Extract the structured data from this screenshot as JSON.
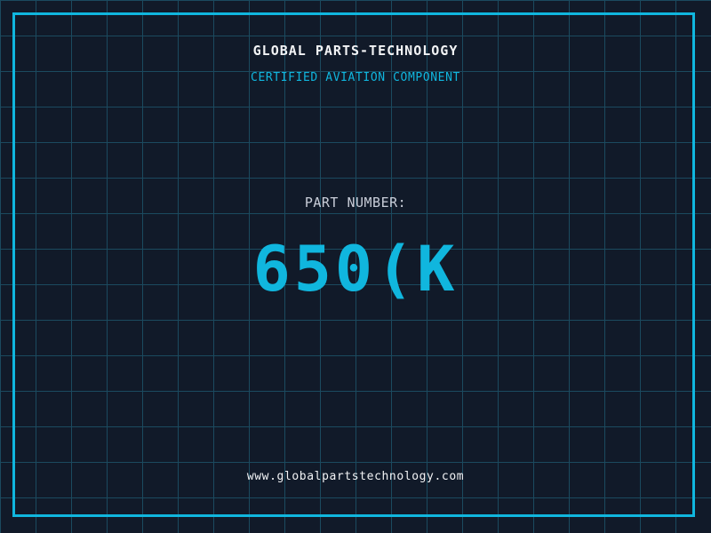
{
  "header": {
    "title": "GLOBAL PARTS-TECHNOLOGY",
    "subtitle": "CERTIFIED AVIATION COMPONENT"
  },
  "part": {
    "label": "PART NUMBER:",
    "number": "650(K"
  },
  "footer": {
    "url": "www.globalpartstechnology.com"
  },
  "colors": {
    "background": "#111a29",
    "grid": "#1b4a5f",
    "accent": "#10b6de",
    "title": "#f2f3f5",
    "muted": "#c9ced9"
  }
}
